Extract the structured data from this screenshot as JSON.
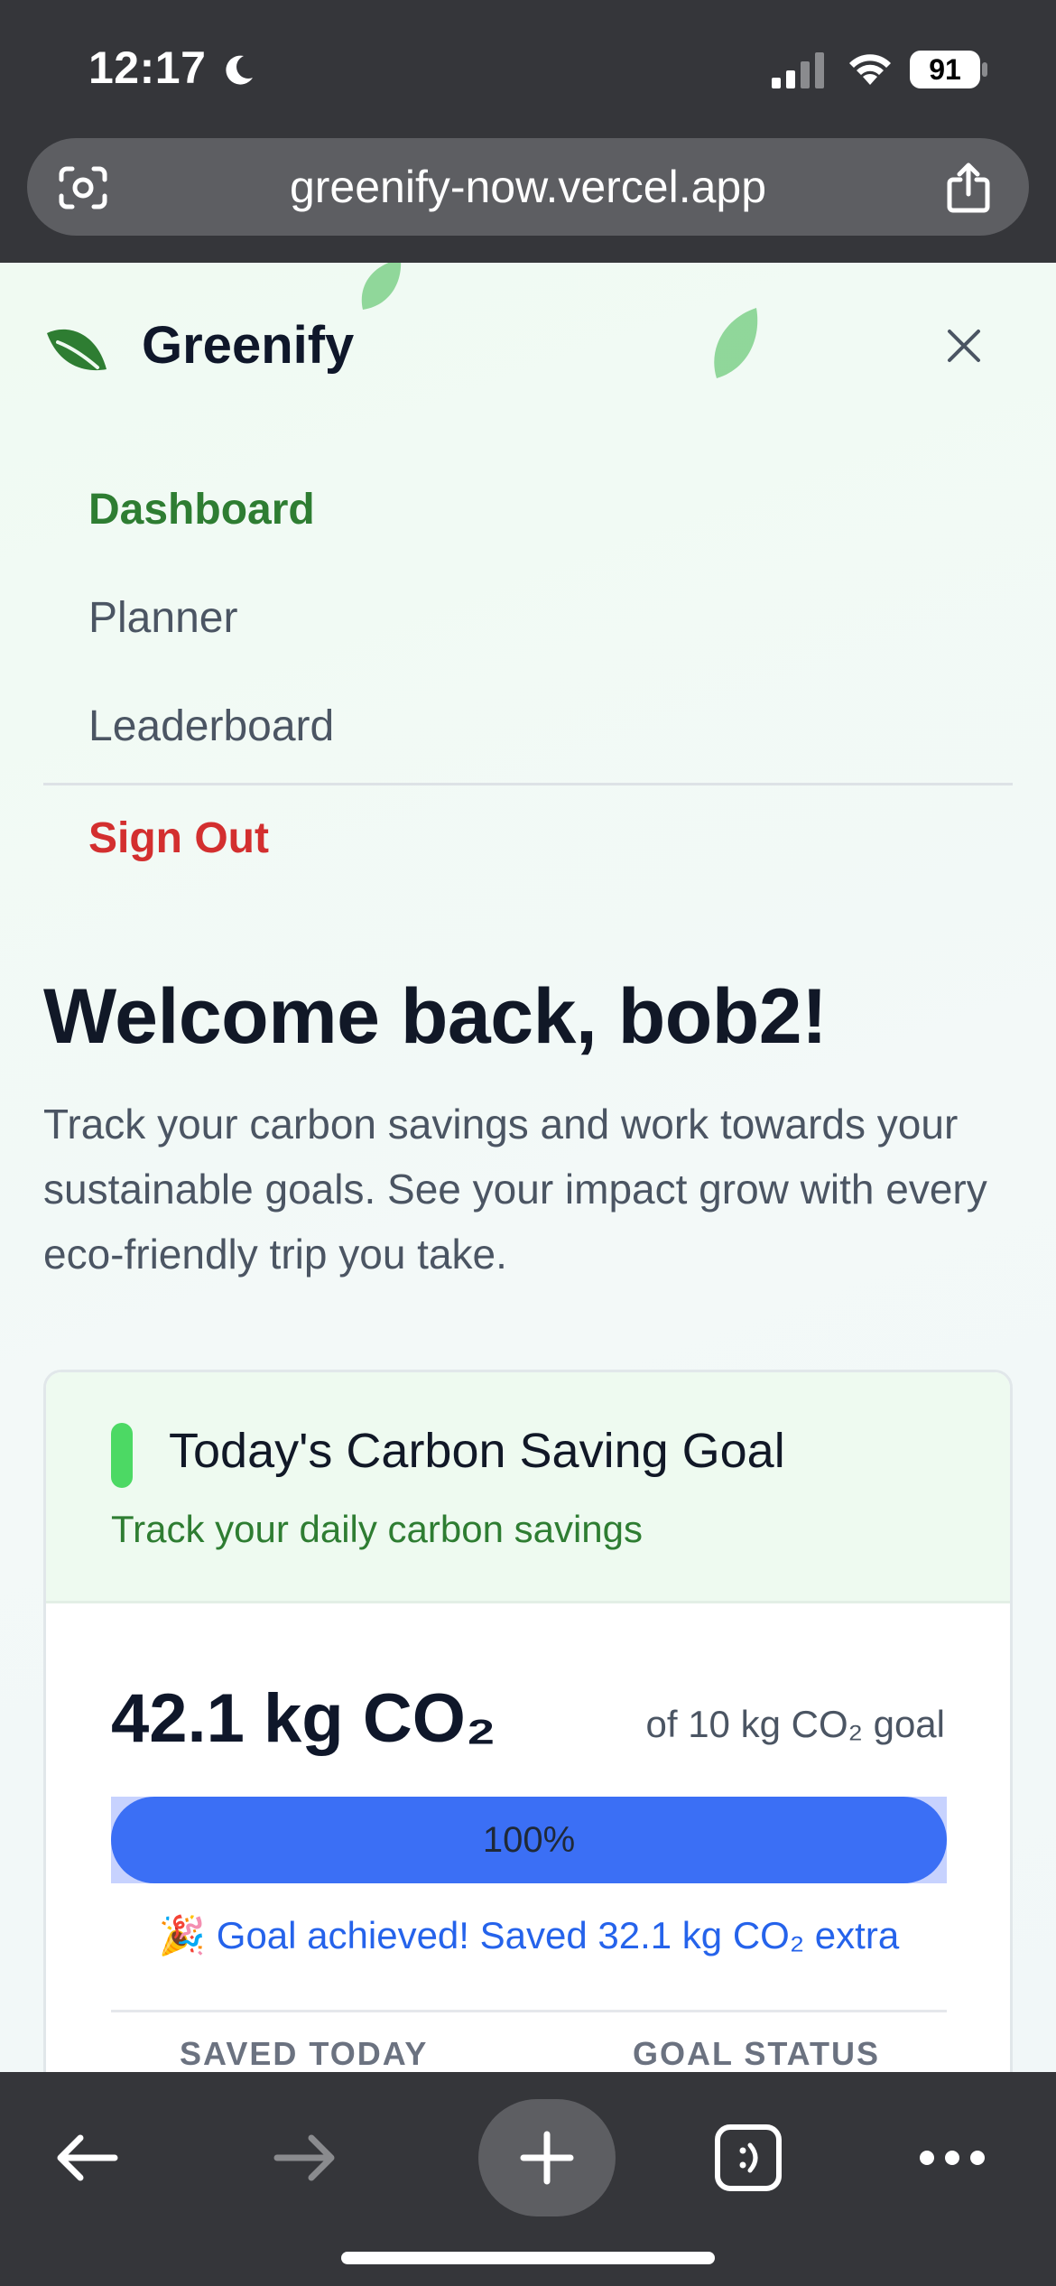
{
  "status_bar": {
    "time": "12:17",
    "battery": "91"
  },
  "browser": {
    "url": "greenify-now.vercel.app"
  },
  "brand": {
    "name": "Greenify"
  },
  "nav": {
    "items": [
      {
        "label": "Dashboard",
        "active": true
      },
      {
        "label": "Planner",
        "active": false
      },
      {
        "label": "Leaderboard",
        "active": false
      }
    ],
    "sign_out": "Sign Out"
  },
  "welcome": {
    "title": "Welcome back, bob2!",
    "subtitle": "Track your carbon savings and work towards your sustainable goals. See your impact grow with every eco-friendly trip you take."
  },
  "goal_card": {
    "title": "Today's Carbon Saving Goal",
    "subtitle": "Track your daily carbon savings",
    "saved": "42.1 kg CO₂",
    "target": "of 10 kg CO₂ goal",
    "progress_label": "100%",
    "progress_fraction": 1.0,
    "achieved_emoji": "🎉",
    "achieved_text": "Goal achieved! Saved 32.1 kg CO₂ extra",
    "stat_labels": [
      "SAVED TODAY",
      "GOAL STATUS"
    ]
  },
  "colors": {
    "brand_green": "#2e7d32",
    "accent_green": "#4cd964",
    "danger_red": "#d32f2f",
    "progress_blue": "#3b6ff5",
    "browser_chrome": "#35363a"
  },
  "icons": {
    "status": [
      "moon-icon",
      "signal-icon",
      "wifi-icon",
      "battery-icon"
    ],
    "toolbar": [
      "back-arrow-icon",
      "forward-arrow-icon",
      "plus-icon",
      "tabs-icon",
      "more-icon"
    ]
  }
}
